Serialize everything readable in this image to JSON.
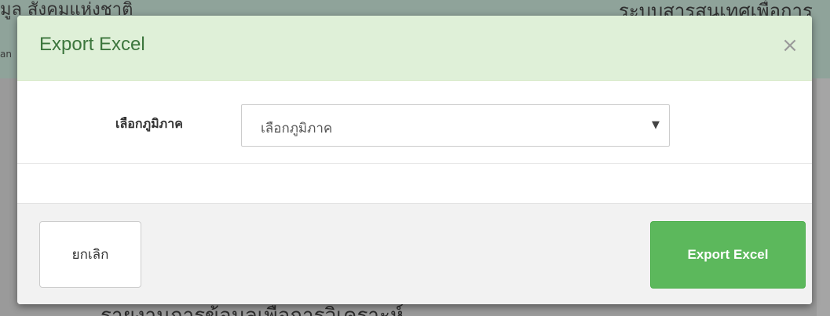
{
  "background": {
    "top_left_text": "ุมูล สังคมแห่งชาติ",
    "top_left_subtext": "an",
    "top_right_text": "ระบบสารสนเทศเพื่อการ",
    "bottom_text": "รายงานการข้อมูลเพื่อการวิเคราะห์"
  },
  "modal": {
    "title": "Export Excel",
    "close_symbol": "×",
    "body": {
      "region_label": "เลือกภูมิภาค",
      "region_select": {
        "selected_value": "เลือกภูมิภาค",
        "caret_symbol": "▼"
      }
    },
    "footer": {
      "cancel_label": "ยกเลิก",
      "export_label": "Export Excel"
    }
  },
  "colors": {
    "header_bg": "#dff0d8",
    "title_color": "#3c763d",
    "export_button_bg": "#5cb85c"
  }
}
